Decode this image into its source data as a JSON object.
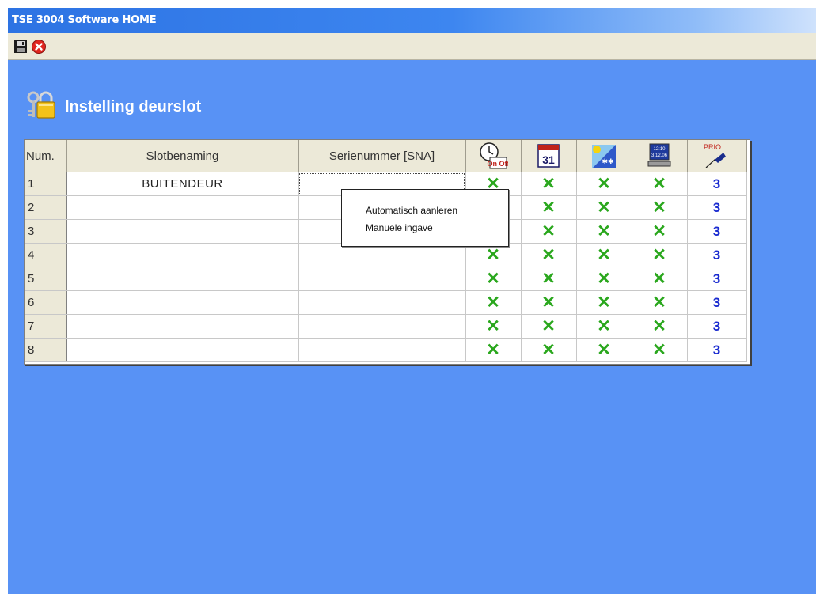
{
  "window": {
    "title": "TSE 3004 Software HOME"
  },
  "toolbar": {
    "save_icon": "floppy-disk-icon",
    "close_icon": "red-close-icon"
  },
  "page": {
    "heading": "Instelling deurslot",
    "heading_icon": "keys-padlock-icon"
  },
  "table": {
    "headers": {
      "num": "Num.",
      "name": "Slotbenaming",
      "serial": "Serienummer [SNA]",
      "icon_columns": [
        "clock-on-off-icon",
        "calendar-31-icon",
        "sun-snow-icon",
        "computer-clock-icon",
        "priority-pen-icon"
      ],
      "calendar_text": "31",
      "computer_time": "12:10",
      "computer_date": "3.12.06",
      "prio_text": "PRIO."
    },
    "check_symbol": "✕",
    "rows": [
      {
        "num": "1",
        "name": "BUITENDEUR",
        "serial": "",
        "prio": "3"
      },
      {
        "num": "2",
        "name": "",
        "serial": "",
        "prio": "3"
      },
      {
        "num": "3",
        "name": "",
        "serial": "",
        "prio": "3"
      },
      {
        "num": "4",
        "name": "",
        "serial": "",
        "prio": "3"
      },
      {
        "num": "5",
        "name": "",
        "serial": "",
        "prio": "3"
      },
      {
        "num": "6",
        "name": "",
        "serial": "",
        "prio": "3"
      },
      {
        "num": "7",
        "name": "",
        "serial": "",
        "prio": "3"
      },
      {
        "num": "8",
        "name": "",
        "serial": "",
        "prio": "3"
      }
    ]
  },
  "context_menu": {
    "items": [
      "Automatisch aanleren",
      "Manuele ingave"
    ]
  },
  "colors": {
    "background": "#5892f5",
    "check": "#2aa71d",
    "prio": "#1a2bd0"
  }
}
